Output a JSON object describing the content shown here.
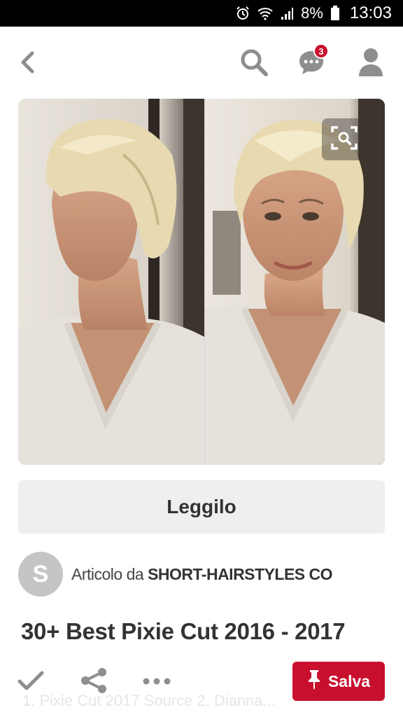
{
  "status_bar": {
    "battery": "8%",
    "time": "13:03",
    "icons": [
      "alarm-icon",
      "wifi-icon",
      "signal-icon",
      "battery-icon"
    ]
  },
  "nav": {
    "back_icon": "chevron-left-icon",
    "search_icon": "search-icon",
    "messages_icon": "chat-bubble-icon",
    "messages_badge": "3",
    "profile_icon": "person-icon"
  },
  "pin": {
    "image_lens_icon": "visual-search-icon",
    "read_label": "Leggilo",
    "source_avatar_letter": "S",
    "source_prefix": "Articolo da ",
    "source_name": "SHORT-HAIRSTYLES CO",
    "title": "30+ Best Pixie Cut 2016 - 2017",
    "subtitle": "1. Pixie Cut 2017 Source 2. Dianna..."
  },
  "toolbar": {
    "check_icon": "check-icon",
    "share_icon": "share-icon",
    "more_icon": "more-dots-icon",
    "save_label": "Salva",
    "save_icon": "pin-icon"
  },
  "colors": {
    "accent": "#c8102e",
    "button_bg": "#efefef",
    "icon_gray": "#8e8e8e"
  }
}
